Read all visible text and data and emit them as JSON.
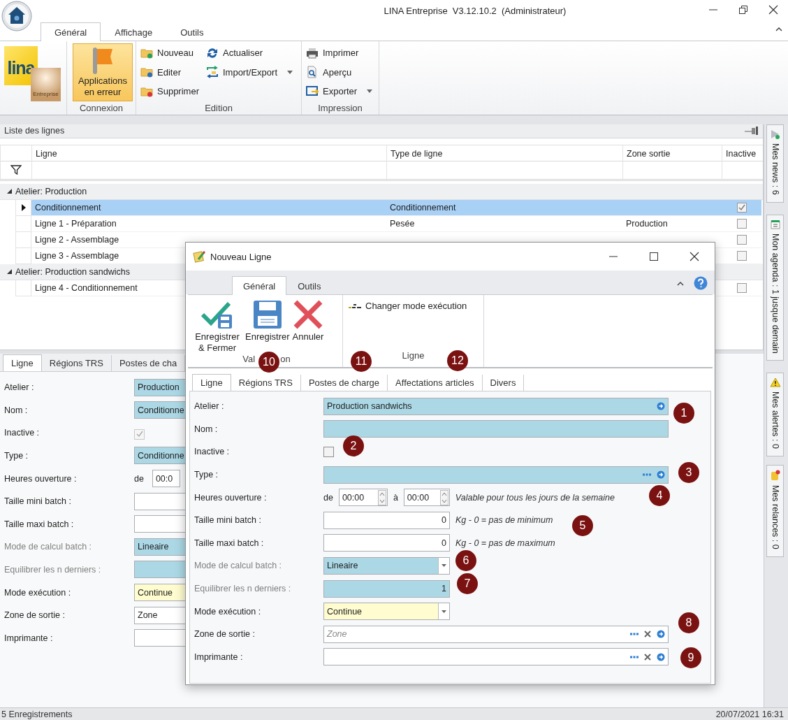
{
  "window": {
    "title": "LINA Entreprise  V3.12.10.2  (Administrateur)"
  },
  "ribbon": {
    "tabs": [
      {
        "label": "Général",
        "selected": true
      },
      {
        "label": "Affichage",
        "selected": false
      },
      {
        "label": "Outils",
        "selected": false
      }
    ],
    "logo": {
      "name": "lina",
      "edition": "Entreprise"
    },
    "groups": [
      {
        "label": "Connexion",
        "kind": "large",
        "items": [
          {
            "label": "Applications en erreur",
            "active": true
          }
        ]
      },
      {
        "label": "Edition",
        "kind": "small",
        "columns": [
          [
            {
              "label": "Nouveau",
              "dropdown": false
            },
            {
              "label": "Editer",
              "dropdown": false
            },
            {
              "label": "Supprimer",
              "dropdown": false
            }
          ],
          [
            {
              "label": "Actualiser",
              "dropdown": false
            },
            {
              "label": "Import/Export",
              "dropdown": true
            }
          ]
        ]
      },
      {
        "label": "Impression",
        "kind": "small",
        "columns": [
          [
            {
              "label": "Imprimer",
              "dropdown": false
            },
            {
              "label": "Aperçu",
              "dropdown": false
            },
            {
              "label": "Exporter",
              "dropdown": true
            }
          ]
        ]
      }
    ]
  },
  "list": {
    "title": "Liste des lignes",
    "columns": [
      "Ligne",
      "Type de ligne",
      "Zone sortie",
      "Inactive"
    ],
    "groups": [
      {
        "label": "Atelier: Production",
        "expanded": true,
        "rows": [
          {
            "ligne": "Conditionnement",
            "type": "Conditionnement",
            "inactive": true,
            "selected": true
          },
          {
            "ligne": "Ligne 1 - Préparation",
            "type": "Pesée",
            "zone": "Production",
            "inactive": false,
            "selected": false
          },
          {
            "ligne": "Ligne 2 - Assemblage",
            "inactive": false,
            "selected": false
          },
          {
            "ligne": "Ligne 3 - Assemblage",
            "inactive": false,
            "selected": false
          }
        ]
      },
      {
        "label": "Atelier: Production sandwichs",
        "expanded": true,
        "rows": [
          {
            "ligne": "Ligne 4 - Conditionnement",
            "inactive": false,
            "selected": false
          }
        ]
      }
    ]
  },
  "detail": {
    "tabs": [
      {
        "label": "Ligne",
        "selected": true
      },
      {
        "label": "Régions TRS",
        "selected": false
      },
      {
        "label": "Postes de cha",
        "selected": false
      }
    ],
    "fields": [
      {
        "kind": "lookup",
        "label": "Atelier :",
        "value": "Production",
        "color": "#acd8e6",
        "disabled": false
      },
      {
        "kind": "lookup",
        "label": "Nom :",
        "value": "Conditionne",
        "color": "#acd8e6",
        "disabled": false
      },
      {
        "kind": "checkbox",
        "label": "Inactive :",
        "checked": true,
        "disabled": true
      },
      {
        "kind": "lookup",
        "label": "Type :",
        "value": "Conditionne",
        "color": "#acd8e6",
        "disabled": false
      },
      {
        "kind": "hours",
        "label": "Heures ouverture :",
        "from_label": "de",
        "from": "00:0"
      },
      {
        "kind": "number",
        "label": "Taille mini batch :",
        "color": "#ffffff",
        "disabled": false
      },
      {
        "kind": "number",
        "label": "Taille maxi batch :",
        "color": "#ffffff",
        "disabled": false
      },
      {
        "kind": "combo",
        "label": "Mode de calcul batch :",
        "value": "Lineaire",
        "color": "#acd8e6",
        "disabled": true
      },
      {
        "kind": "number",
        "label": "Equilibrer les n derniers :",
        "color": "#acd8e6",
        "disabled": true
      },
      {
        "kind": "combo",
        "label": "Mode exécution :",
        "value": "Continue",
        "color": "#fffdd0",
        "disabled": false
      },
      {
        "kind": "lookup",
        "label": "Zone de sortie :",
        "value": "Zone",
        "color": "#ffffff",
        "disabled": false
      },
      {
        "kind": "lookup",
        "label": "Imprimante :",
        "color": "#ffffff",
        "disabled": false
      }
    ]
  },
  "dialog": {
    "title": "Nouveau Ligne",
    "tabs": [
      {
        "label": "Général",
        "selected": true
      },
      {
        "label": "Outils",
        "selected": false
      }
    ],
    "groups": [
      {
        "label_start": "Val",
        "label_end": "on",
        "kind": "large",
        "items": [
          {
            "label": "Enregistrer & Fermer"
          },
          {
            "label": "Enregistrer"
          },
          {
            "label": "Annuler"
          }
        ]
      },
      {
        "label": "Ligne",
        "kind": "small",
        "items": [
          {
            "label": "Changer mode exécution"
          }
        ]
      }
    ],
    "form": {
      "tabs": [
        {
          "label": "Ligne",
          "selected": true
        },
        {
          "label": "Régions TRS",
          "selected": false
        },
        {
          "label": "Postes de charge",
          "selected": false
        },
        {
          "label": "Affectations articles",
          "selected": false
        },
        {
          "label": "Divers",
          "selected": false
        }
      ],
      "fields": [
        {
          "kind": "lookup",
          "label": "Atelier :",
          "value": "Production sandwichs",
          "color": "#acd8e6",
          "ellipsis": false,
          "clear": false,
          "open": true,
          "disabled": false
        },
        {
          "kind": "lookup",
          "label": "Nom :",
          "color": "#acd8e6",
          "ellipsis": false,
          "clear": false,
          "open": false,
          "disabled": false
        },
        {
          "kind": "checkbox",
          "label": "Inactive :",
          "checked": false,
          "disabled": false
        },
        {
          "kind": "lookup",
          "label": "Type :",
          "color": "#acd8e6",
          "ellipsis": true,
          "clear": false,
          "open": true,
          "disabled": false
        },
        {
          "kind": "hours",
          "label": "Heures ouverture :",
          "from_label": "de",
          "from": "00:00",
          "to_label": "à",
          "to": "00:00",
          "spin": true,
          "note": "Valable pour tous les jours de la semaine"
        },
        {
          "kind": "number",
          "label": "Taille mini batch :",
          "value": "0",
          "color": "#ffffff",
          "note": "Kg - 0 = pas de minimum",
          "disabled": false
        },
        {
          "kind": "number",
          "label": "Taille maxi batch :",
          "value": "0",
          "color": "#ffffff",
          "note": "Kg - 0 = pas de maximum",
          "disabled": false
        },
        {
          "kind": "combo",
          "label": "Mode de calcul batch :",
          "value": "Lineaire",
          "color": "#acd8e6",
          "dropdown": true,
          "disabled": true
        },
        {
          "kind": "number",
          "label": "Equilibrer les n derniers :",
          "value": "1",
          "color": "#acd8e6",
          "disabled": true
        },
        {
          "kind": "combo",
          "label": "Mode exécution :",
          "value": "Continue",
          "color": "#fffdd0",
          "dropdown": true,
          "disabled": false
        },
        {
          "kind": "lookup",
          "label": "Zone de sortie :",
          "placeholder": "Zone",
          "color": "#ffffff",
          "ellipsis": true,
          "clear": true,
          "open": true,
          "disabled": false
        },
        {
          "kind": "lookup",
          "label": "Imprimante :",
          "color": "#ffffff",
          "ellipsis": true,
          "clear": true,
          "open": true,
          "disabled": false
        }
      ]
    },
    "badges": [
      "1",
      "2",
      "3",
      "4",
      "5",
      "6",
      "7",
      "8",
      "9",
      "10",
      "11",
      "12"
    ]
  },
  "sidebar": [
    "Mes news : 6",
    "Mon agenda : 1 jusque demain",
    "Mes alertes : 0",
    "Mes relances : 0"
  ],
  "status_bar": {
    "count": "5 Enregistrements",
    "datetime": "20/07/2021 16:31"
  }
}
